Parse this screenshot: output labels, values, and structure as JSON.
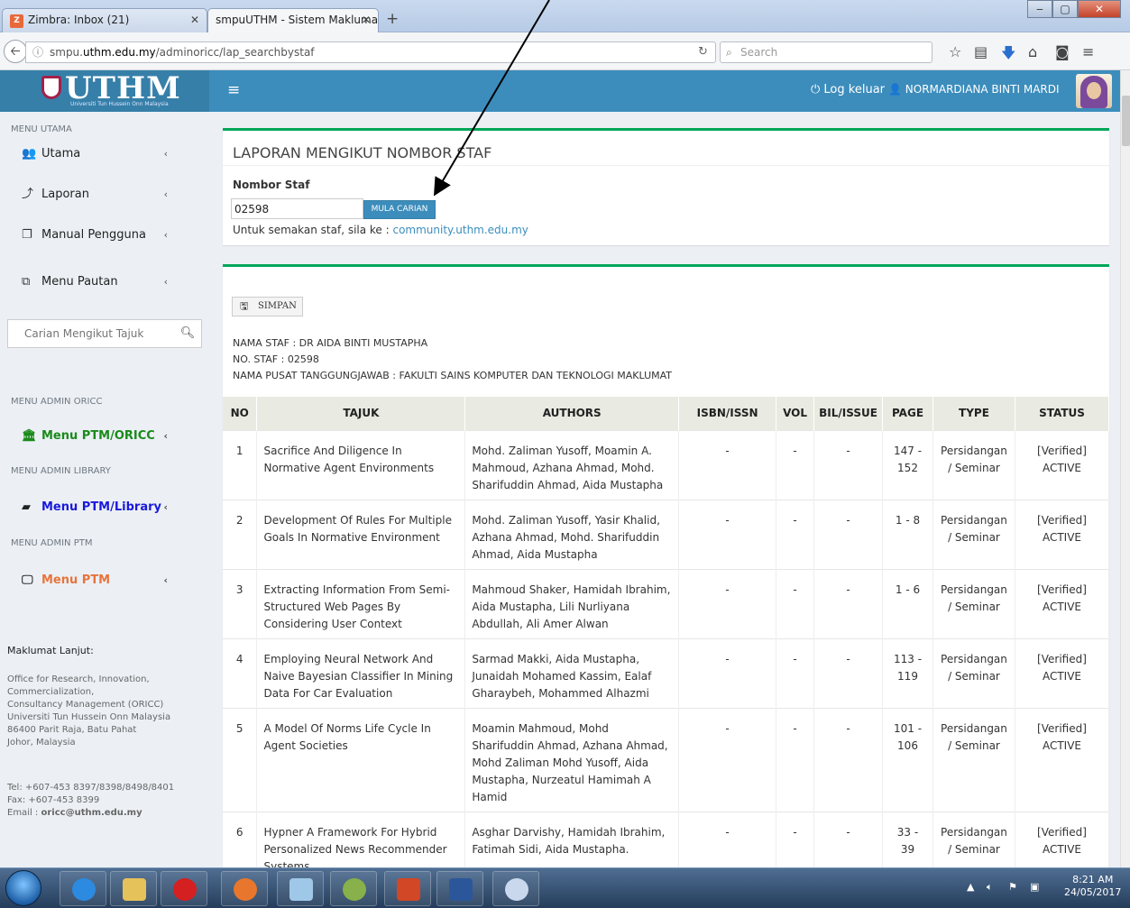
{
  "browser": {
    "tabs": [
      {
        "label": "Zimbra: Inbox (21)",
        "icon": "zimbra-icon"
      },
      {
        "label": "smpuUTHM - Sistem Maklumat P"
      }
    ],
    "url_prefix": "smpu.",
    "url_domain": "uthm.edu.my",
    "url_path": "/adminoricc/lap_searchbystaf",
    "search_placeholder": "Search"
  },
  "header": {
    "logo_text": "UTHM",
    "logo_subtitle": "Universiti Tun Hussein Onn Malaysia",
    "logout_label": "Log keluar",
    "user_name": "NORMARDIANA BINTI MARDI"
  },
  "sidebar": {
    "section_main": "MENU UTAMA",
    "items": [
      {
        "label": "Utama",
        "icon": "users-icon"
      },
      {
        "label": "Laporan",
        "icon": "chart-icon"
      },
      {
        "label": "Manual Pengguna",
        "icon": "copy-icon"
      },
      {
        "label": "Menu Pautan",
        "icon": "external-link-icon"
      }
    ],
    "search_placeholder": "Carian Mengikut Tajuk",
    "section_oricc": "MENU ADMIN ORICC",
    "oricc_label": "Menu PTM/ORICC",
    "oricc_color": "#1a8a1a",
    "section_library": "MENU ADMIN LIBRARY",
    "library_label": "Menu PTM/Library",
    "library_color": "#1a1adb",
    "section_ptm": "MENU ADMIN PTM",
    "ptm_label": "Menu PTM",
    "ptm_color": "#e8743b",
    "info_title": "Maklumat Lanjut:",
    "info_lines": [
      "Office for Research, Innovation,",
      "Commercialization,",
      "Consultancy Management (ORICC)",
      "Universiti Tun Hussein Onn Malaysia",
      "86400 Parit Raja, Batu Pahat",
      "Johor, Malaysia"
    ],
    "tel": "Tel: +607-453 8397/8398/8498/8401",
    "fax": "Fax: +607-453 8399",
    "email_label": "Email : ",
    "email": "oricc@uthm.edu.my"
  },
  "search_box": {
    "title": "LAPORAN MENGIKUT NOMBOR STAF",
    "field_label": "Nombor Staf",
    "field_value": "02598",
    "button_label": "MULA CARIAN",
    "note_prefix": "Untuk semakan staf, sila ke : ",
    "note_link": "community.uthm.edu.my"
  },
  "report": {
    "save_label": "SIMPAN",
    "staff_name": "NAMA STAF : DR AIDA BINTI MUSTAPHA",
    "staff_no": "NO. STAF : 02598",
    "centre": "NAMA PUSAT TANGGUNGJAWAB : FAKULTI SAINS KOMPUTER DAN TEKNOLOGI MAKLUMAT",
    "columns": [
      "NO",
      "TAJUK",
      "AUTHORS",
      "ISBN/ISSN",
      "VOL",
      "BIL/ISSUE",
      "PAGE",
      "TYPE",
      "STATUS"
    ],
    "rows": [
      {
        "no": "1",
        "tajuk": "Sacrifice And Diligence In Normative Agent Environments",
        "authors": "Mohd. Zaliman Yusoff, Moamin A. Mahmoud, Azhana Ahmad, Mohd. Sharifuddin Ahmad, Aida Mustapha",
        "isbn": "-",
        "vol": "-",
        "bil": "-",
        "page": "147 - 152",
        "type": "Persidangan / Seminar",
        "status": "[Verified] ACTIVE"
      },
      {
        "no": "2",
        "tajuk": "Development Of Rules For Multiple Goals In Normative Environment",
        "authors": "Mohd. Zaliman Yusoff, Yasir Khalid, Azhana Ahmad, Mohd. Sharifuddin Ahmad, Aida Mustapha",
        "isbn": "-",
        "vol": "-",
        "bil": "-",
        "page": "1 - 8",
        "type": "Persidangan / Seminar",
        "status": "[Verified] ACTIVE"
      },
      {
        "no": "3",
        "tajuk": "Extracting Information From Semi-Structured Web Pages By Considering User Context",
        "authors": "Mahmoud Shaker, Hamidah Ibrahim, Aida Mustapha, Lili Nurliyana Abdullah, Ali Amer Alwan",
        "isbn": "-",
        "vol": "-",
        "bil": "-",
        "page": "1 - 6",
        "type": "Persidangan / Seminar",
        "status": "[Verified] ACTIVE"
      },
      {
        "no": "4",
        "tajuk": "Employing Neural Network And Naive Bayesian Classifier In Mining Data For Car Evaluation",
        "authors": "Sarmad Makki, Aida Mustapha, Junaidah Mohamed Kassim, Ealaf Gharaybeh, Mohammed Alhazmi",
        "isbn": "-",
        "vol": "-",
        "bil": "-",
        "page": "113 - 119",
        "type": "Persidangan / Seminar",
        "status": "[Verified] ACTIVE"
      },
      {
        "no": "5",
        "tajuk": "A Model Of Norms Life Cycle In Agent Societies",
        "authors": "Moamin Mahmoud, Mohd Sharifuddin Ahmad, Azhana Ahmad, Mohd Zaliman Mohd Yusoff, Aida Mustapha, Nurzeatul Hamimah A Hamid",
        "isbn": "-",
        "vol": "-",
        "bil": "-",
        "page": "101 - 106",
        "type": "Persidangan / Seminar",
        "status": "[Verified] ACTIVE"
      },
      {
        "no": "6",
        "tajuk": "Hypner A Framework For Hybrid Personalized News Recommender Systems",
        "authors": "Asghar Darvishy, Hamidah Ibrahim, Fatimah Sidi, Aida Mustapha.",
        "isbn": "-",
        "vol": "-",
        "bil": "-",
        "page": "33 - 39",
        "type": "Persidangan / Seminar",
        "status": "[Verified] ACTIVE"
      }
    ]
  },
  "taskbar": {
    "time": "8:21 AM",
    "date": "24/05/2017",
    "apps": [
      "ie-icon",
      "explorer-icon",
      "opera-icon",
      "firefox-icon",
      "virtualbox-icon",
      "game-icon",
      "powerpoint-icon",
      "word-icon",
      "paint-icon"
    ]
  }
}
